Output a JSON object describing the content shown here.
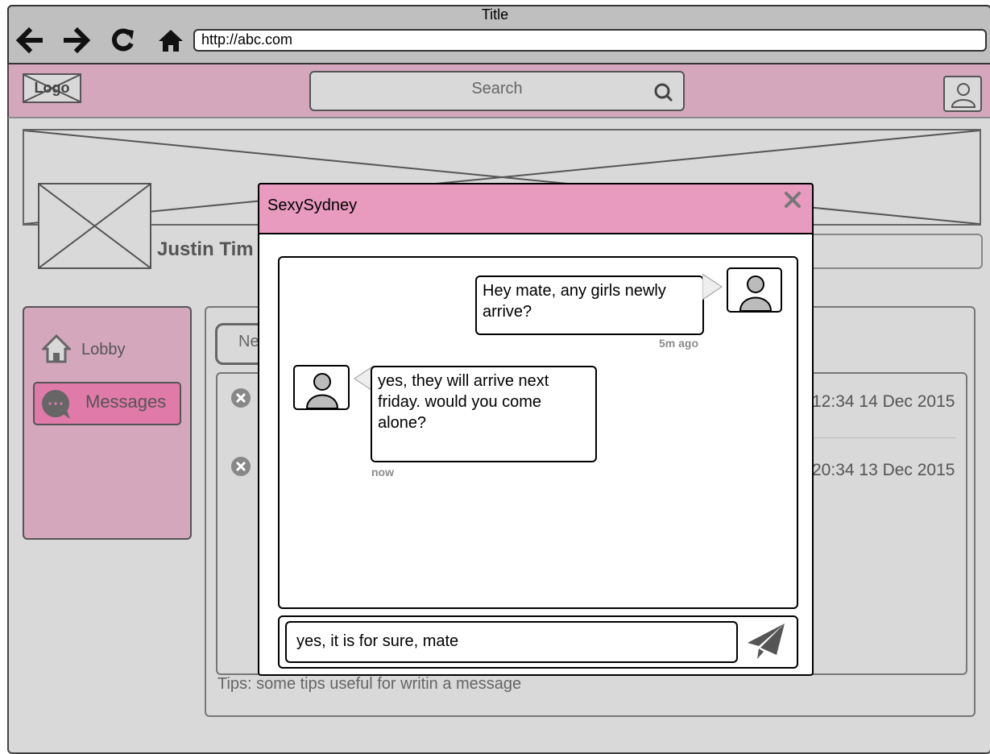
{
  "browser": {
    "title": "Title",
    "url": "http://abc.com",
    "nav_icons": [
      "back-arrow-icon",
      "forward-arrow-icon",
      "reload-icon",
      "home-icon"
    ]
  },
  "header": {
    "logo_text": "Logo",
    "search_placeholder": "Search",
    "search_icon": "search-icon",
    "avatar_icon": "user-avatar-icon"
  },
  "profile": {
    "name": "Justin Tim"
  },
  "sidebar": {
    "items": [
      {
        "label": "Lobby",
        "icon": "home-icon"
      },
      {
        "label": "Messages",
        "icon": "chat-bubble-icon"
      }
    ]
  },
  "main": {
    "new_button_label": "Ne",
    "rows": [
      {
        "date": "12:34 14 Dec 2015"
      },
      {
        "date": "20:34 13 Dec 2015"
      }
    ],
    "tips": "Tips: some tips useful for writin a message"
  },
  "dialog": {
    "title": "SexySydney",
    "messages": [
      {
        "from": "me",
        "text": "Hey mate, any girls newly arrive?",
        "time": "5m ago"
      },
      {
        "from": "them",
        "text": "yes, they will arrive next friday. would you come alone?",
        "time": "now"
      }
    ],
    "input_value": "yes, it is for sure, mate"
  },
  "colors": {
    "header_pink": "#d4a7bd",
    "dialog_header": "#e89abf",
    "active_nav": "#e07aa8",
    "background": "#d9d9d9"
  }
}
